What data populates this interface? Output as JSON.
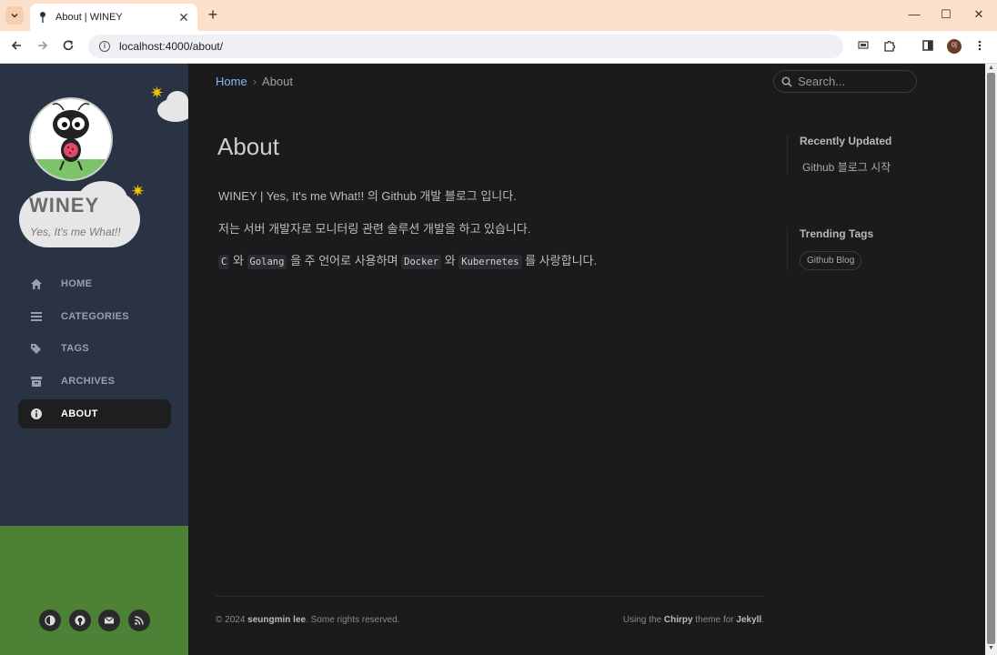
{
  "browser": {
    "tab_title": "About | WINEY",
    "tab_close": "✕",
    "new_tab": "+",
    "url": "localhost:4000/about/",
    "profile_initial": "이",
    "win_minimize": "—",
    "win_restore": "☐",
    "win_close": "✕"
  },
  "sidebar": {
    "title": "WINEY",
    "subtitle": "Yes, It's me What!!",
    "nav": [
      {
        "label": "HOME",
        "icon": "home-icon"
      },
      {
        "label": "CATEGORIES",
        "icon": "stream-icon"
      },
      {
        "label": "TAGS",
        "icon": "tags-icon"
      },
      {
        "label": "ARCHIVES",
        "icon": "archive-icon"
      },
      {
        "label": "ABOUT",
        "icon": "info-circle-icon",
        "active": true
      }
    ],
    "social": [
      "theme-toggle-icon",
      "github-icon",
      "email-icon",
      "rss-icon"
    ]
  },
  "main": {
    "breadcrumb": {
      "home": "Home",
      "sep": "›",
      "current": "About"
    },
    "search_placeholder": "Search...",
    "title": "About",
    "p1": "WINEY | Yes, It's me What!! 의 Github 개발 블로그 입니다.",
    "p2": "저는 서버 개발자로 모니터링 관련 솔루션 개발을 하고 있습니다.",
    "p3": {
      "c": "C",
      "t1": " 와 ",
      "golang": "Golang",
      "t2": " 을 주 언어로 사용하며 ",
      "docker": "Docker",
      "t3": " 와 ",
      "k8s": "Kubernetes",
      "t4": " 를 사랑합니다."
    }
  },
  "panel": {
    "recent_heading": "Recently Updated",
    "recent_item": "Github 블로그 시작",
    "trending_heading": "Trending Tags",
    "tag": "Github Blog"
  },
  "footer": {
    "copyright_prefix": "© 2024 ",
    "author": "seungmin lee",
    "copyright_suffix": ". Some rights reserved.",
    "theme_prefix": "Using the ",
    "theme": "Chirpy",
    "theme_mid": " theme for ",
    "engine": "Jekyll",
    "theme_suffix": "."
  }
}
